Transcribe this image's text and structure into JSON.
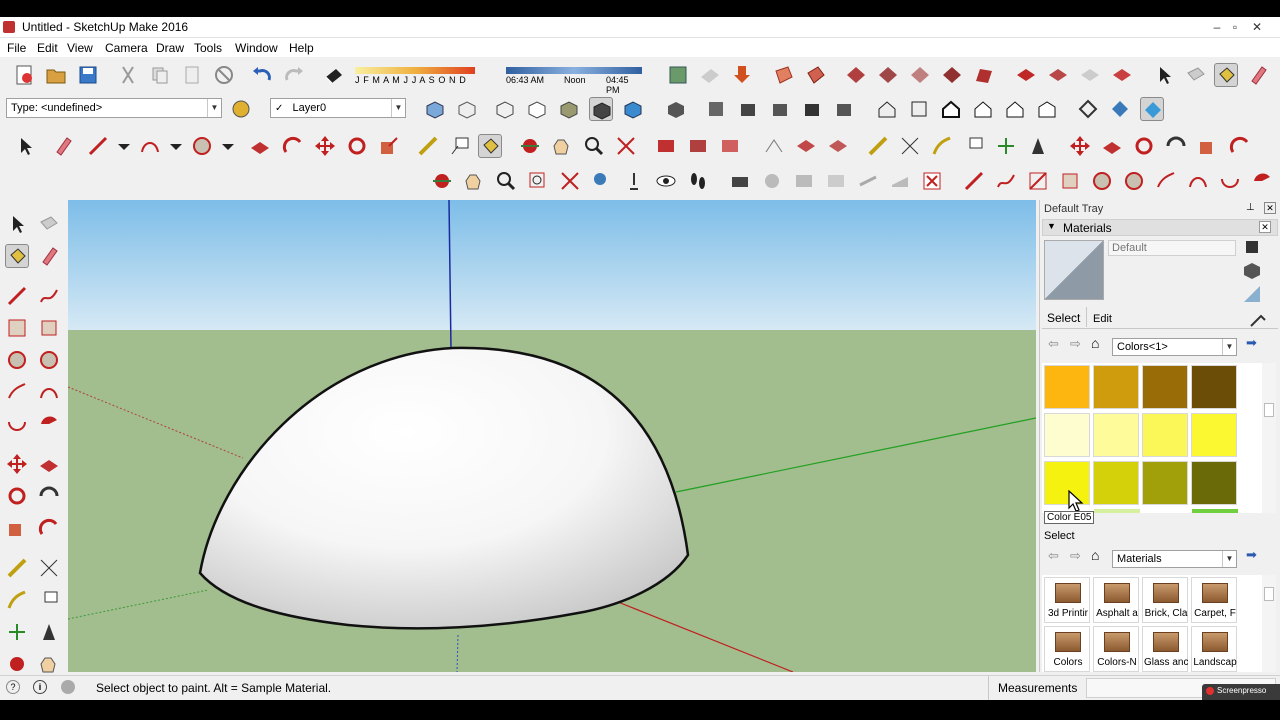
{
  "window": {
    "title": "Untitled - SketchUp Make 2016"
  },
  "menu": [
    "File",
    "Edit",
    "View",
    "Camera",
    "Draw",
    "Tools",
    "Window",
    "Help"
  ],
  "shadow": {
    "months": "J F M A M J J A S O N D",
    "time_start": "06:43 AM",
    "time_mid": "Noon",
    "time_end": "04:45 PM"
  },
  "type_combo": {
    "value": "Type: <undefined>"
  },
  "layer_combo": {
    "check": "✓",
    "value": "Layer0"
  },
  "tray": {
    "title": "Default Tray",
    "panel_title": "Materials",
    "material_name": "Default",
    "tabs": [
      "Select",
      "Edit"
    ],
    "collection": "Colors<1>",
    "tooltip": "Color E05",
    "section2": "Select",
    "collection2": "Materials",
    "swatches": [
      "#fdb50f",
      "#cf9c0e",
      "#9a6c08",
      "#6b4d07",
      "#fdfdd0",
      "#fdfb9a",
      "#fbf758",
      "#fbf730",
      "#f5f210",
      "#d4d00a",
      "#a2a00a",
      "#6a6a08"
    ],
    "libraries": [
      "3d Printir",
      "Asphalt a",
      "Brick, Cla",
      "Carpet, F",
      "Colors",
      "Colors-N",
      "Glass anc",
      "Landscap"
    ]
  },
  "status": {
    "hint": "Select object to paint. Alt = Sample Material.",
    "measure_label": "Measurements",
    "watermark": "Screenpresso"
  }
}
